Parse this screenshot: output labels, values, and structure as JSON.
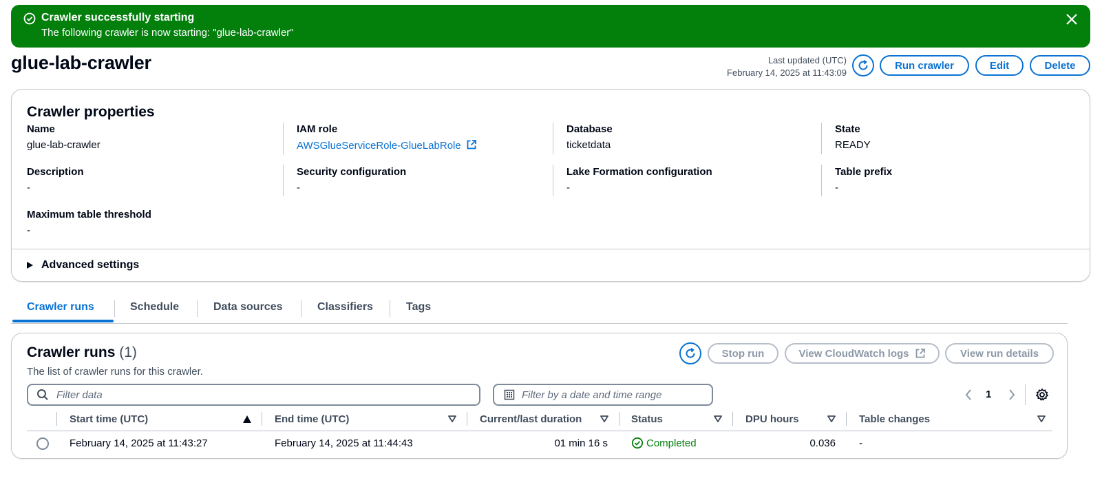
{
  "flash": {
    "title": "Crawler successfully starting",
    "message": "The following crawler is now starting: \"glue-lab-crawler\""
  },
  "header": {
    "title": "glue-lab-crawler",
    "last_updated_label": "Last updated (UTC)",
    "last_updated_value": "February 14, 2025 at 11:43:09",
    "run_button": "Run crawler",
    "edit_button": "Edit",
    "delete_button": "Delete"
  },
  "properties": {
    "heading": "Crawler properties",
    "fields": [
      {
        "label": "Name",
        "value": "glue-lab-crawler"
      },
      {
        "label": "IAM role",
        "value": "AWSGlueServiceRole-GlueLabRole"
      },
      {
        "label": "Database",
        "value": "ticketdata"
      },
      {
        "label": "State",
        "value": "READY"
      },
      {
        "label": "Description",
        "value": "-"
      },
      {
        "label": "Security configuration",
        "value": "-"
      },
      {
        "label": "Lake Formation configuration",
        "value": "-"
      },
      {
        "label": "Table prefix",
        "value": "-"
      },
      {
        "label": "Maximum table threshold",
        "value": "-"
      }
    ],
    "advanced": "Advanced settings"
  },
  "tabs": [
    "Crawler runs",
    "Schedule",
    "Data sources",
    "Classifiers",
    "Tags"
  ],
  "runs": {
    "heading": "Crawler runs",
    "count": "(1)",
    "description": "The list of crawler runs for this crawler.",
    "stop_button": "Stop run",
    "cloudwatch_button": "View CloudWatch logs",
    "details_button": "View run details",
    "filter_placeholder": "Filter data",
    "date_filter_placeholder": "Filter by a date and time range",
    "page": "1",
    "columns": [
      "Start time (UTC)",
      "End time (UTC)",
      "Current/last duration",
      "Status",
      "DPU hours",
      "Table changes"
    ],
    "rows": [
      {
        "start": "February 14, 2025 at 11:43:27",
        "end": "February 14, 2025 at 11:44:43",
        "duration": "01 min 16 s",
        "status": "Completed",
        "dpu": "0.036",
        "changes": "-"
      }
    ]
  },
  "colors": {
    "success": "#037f0c",
    "link": "#0972d3",
    "border": "#c6c6cd"
  }
}
